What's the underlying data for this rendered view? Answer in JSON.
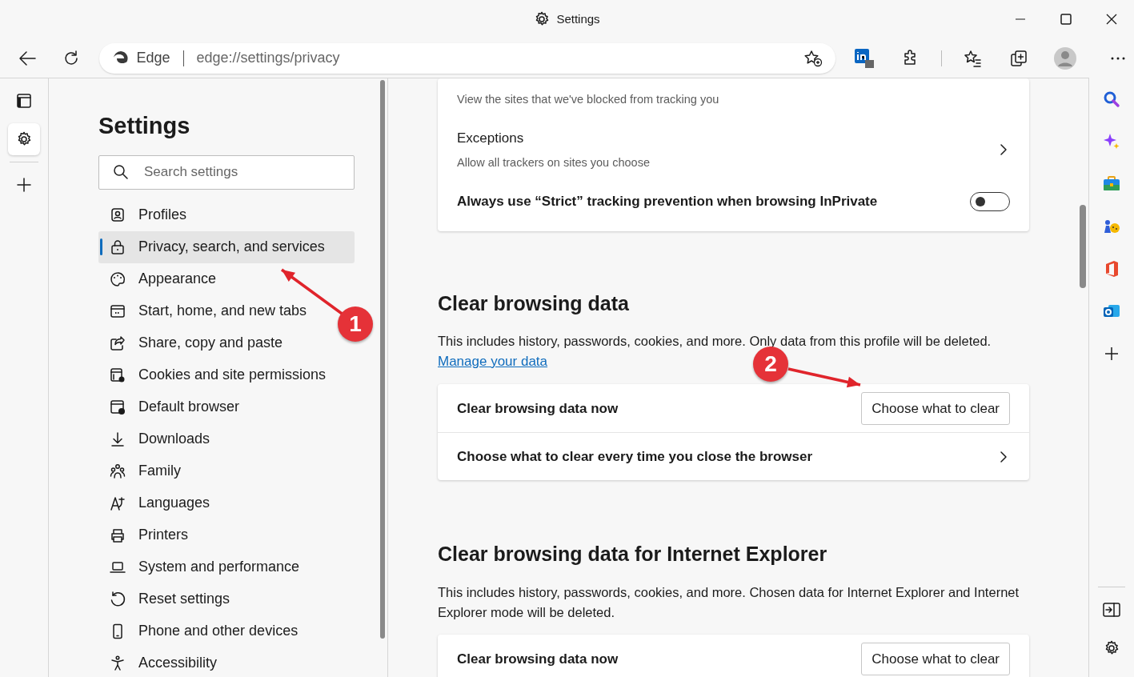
{
  "window": {
    "title": "Settings"
  },
  "toolbar": {
    "brand": "Edge",
    "address": "edge://settings/privacy"
  },
  "sidebar": {
    "title": "Settings",
    "search": {
      "placeholder": "Search settings"
    },
    "items": [
      {
        "label": "Profiles",
        "selected": false
      },
      {
        "label": "Privacy, search, and services",
        "selected": true
      },
      {
        "label": "Appearance",
        "selected": false
      },
      {
        "label": "Start, home, and new tabs",
        "selected": false
      },
      {
        "label": "Share, copy and paste",
        "selected": false
      },
      {
        "label": "Cookies and site permissions",
        "selected": false
      },
      {
        "label": "Default browser",
        "selected": false
      },
      {
        "label": "Downloads",
        "selected": false
      },
      {
        "label": "Family",
        "selected": false
      },
      {
        "label": "Languages",
        "selected": false
      },
      {
        "label": "Printers",
        "selected": false
      },
      {
        "label": "System and performance",
        "selected": false
      },
      {
        "label": "Reset settings",
        "selected": false
      },
      {
        "label": "Phone and other devices",
        "selected": false
      },
      {
        "label": "Accessibility",
        "selected": false
      }
    ]
  },
  "tracking_card": {
    "rows": [
      {
        "kind": "caption",
        "text": "View the sites that we've blocked from tracking you"
      },
      {
        "kind": "link",
        "title": "Exceptions",
        "subtitle": "Allow all trackers on sites you choose"
      },
      {
        "kind": "toggle",
        "title": "Always use “Strict” tracking prevention when browsing InPrivate",
        "on": false
      }
    ]
  },
  "sections": [
    {
      "heading": "Clear browsing data",
      "description": "This includes history, passwords, cookies, and more. Only data from this profile will be deleted.",
      "link": "Manage your data",
      "rows": [
        {
          "kind": "button",
          "title": "Clear browsing data now",
          "button": "Choose what to clear"
        },
        {
          "kind": "link",
          "title": "Choose what to clear every time you close the browser"
        }
      ]
    },
    {
      "heading": "Clear browsing data for Internet Explorer",
      "description": "This includes history, passwords, cookies, and more. Chosen data for Internet Explorer and Internet Explorer mode will be deleted.",
      "rows": [
        {
          "kind": "button",
          "title": "Clear browsing data now",
          "button": "Choose what to clear"
        }
      ]
    }
  ],
  "annotations": [
    {
      "label": "1"
    },
    {
      "label": "2"
    }
  ]
}
